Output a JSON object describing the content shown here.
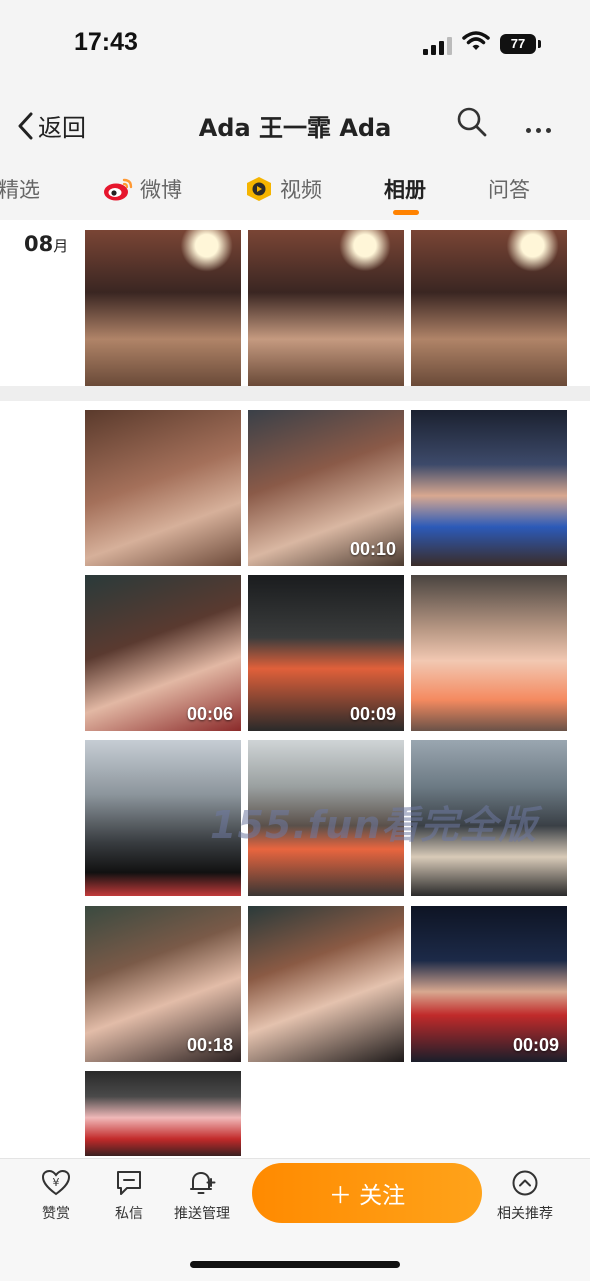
{
  "status": {
    "time": "17:43",
    "battery": "77"
  },
  "nav": {
    "back_label": "返回",
    "title": "Ada 王一霏 Ada"
  },
  "tabs": [
    {
      "label": "精选",
      "icon": ""
    },
    {
      "label": "微博",
      "icon": "weibo-icon"
    },
    {
      "label": "视频",
      "icon": "video-channel-icon"
    },
    {
      "label": "相册",
      "icon": "",
      "active": true
    },
    {
      "label": "问答",
      "icon": ""
    }
  ],
  "album": {
    "month_num": "08",
    "month_unit": "月",
    "photos": [
      {
        "duration": ""
      },
      {
        "duration": ""
      },
      {
        "duration": ""
      },
      {
        "duration": ""
      },
      {
        "duration": "00:10"
      },
      {
        "duration": ""
      },
      {
        "duration": "00:06"
      },
      {
        "duration": "00:09"
      },
      {
        "duration": ""
      },
      {
        "duration": ""
      },
      {
        "duration": ""
      },
      {
        "duration": ""
      },
      {
        "duration": "00:18"
      },
      {
        "duration": ""
      },
      {
        "duration": "00:09"
      },
      {
        "duration": ""
      }
    ]
  },
  "watermark": "155.fun看完全版",
  "bottom": {
    "reward": "赞赏",
    "message": "私信",
    "push": "推送管理",
    "follow": "＋ 关注",
    "related": "相关推荐"
  },
  "colors": {
    "accent": "#ff8200"
  }
}
